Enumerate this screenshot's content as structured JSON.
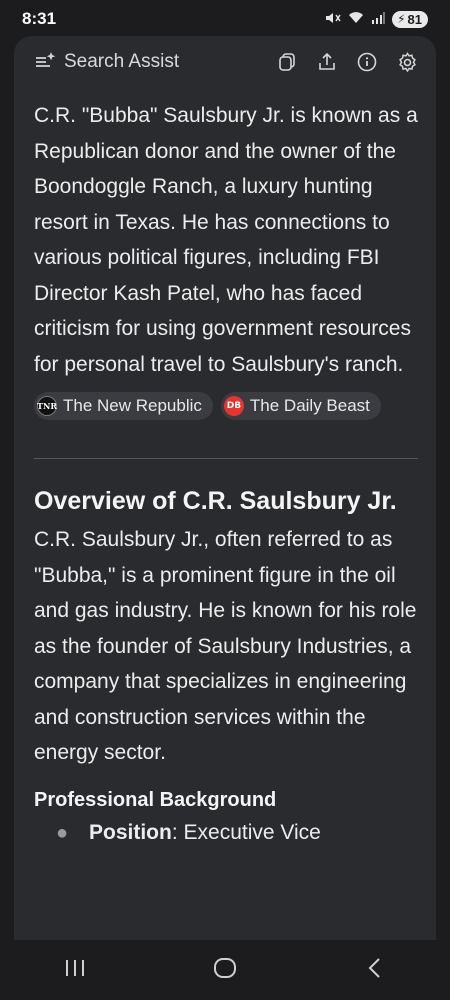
{
  "status": {
    "time": "8:31",
    "battery": "81"
  },
  "header": {
    "title": "Search Assist",
    "icons": [
      "search-assist-icon",
      "copy-icon",
      "share-icon",
      "info-icon",
      "settings-icon"
    ]
  },
  "answer": {
    "summary": "C.R. \"Bubba\" Saulsbury Jr. is known as a Republican donor and the owner of the Boondoggle Ranch, a luxury hunting resort in Texas. He has connections to various political figures, including FBI Director Kash Patel, who has faced criticism for using government resources for personal travel to Saulsbury's ranch.",
    "sources": [
      {
        "logo": "TNR",
        "label": "The New Republic"
      },
      {
        "logo": "DB",
        "label": "The Daily Beast"
      }
    ]
  },
  "overview": {
    "title": "Overview of C.R. Saulsbury Jr.",
    "body": "C.R. Saulsbury Jr., often referred to as \"Bubba,\" is a prominent figure in the oil and gas industry. He is known for his role as the founder of Saulsbury Industries, a company that specializes in engineering and construction services within the energy sector.",
    "subheading": "Professional Background",
    "bullet": {
      "key": "Position",
      "value": ": Executive Vice"
    }
  },
  "nav": {
    "icons": [
      "recent-apps-icon",
      "home-icon",
      "back-icon"
    ]
  },
  "colors": {
    "background": "#1c1c1e",
    "card": "#2a2b2f",
    "chip": "#3b3c41",
    "daily_beast_red": "#e8332f"
  }
}
